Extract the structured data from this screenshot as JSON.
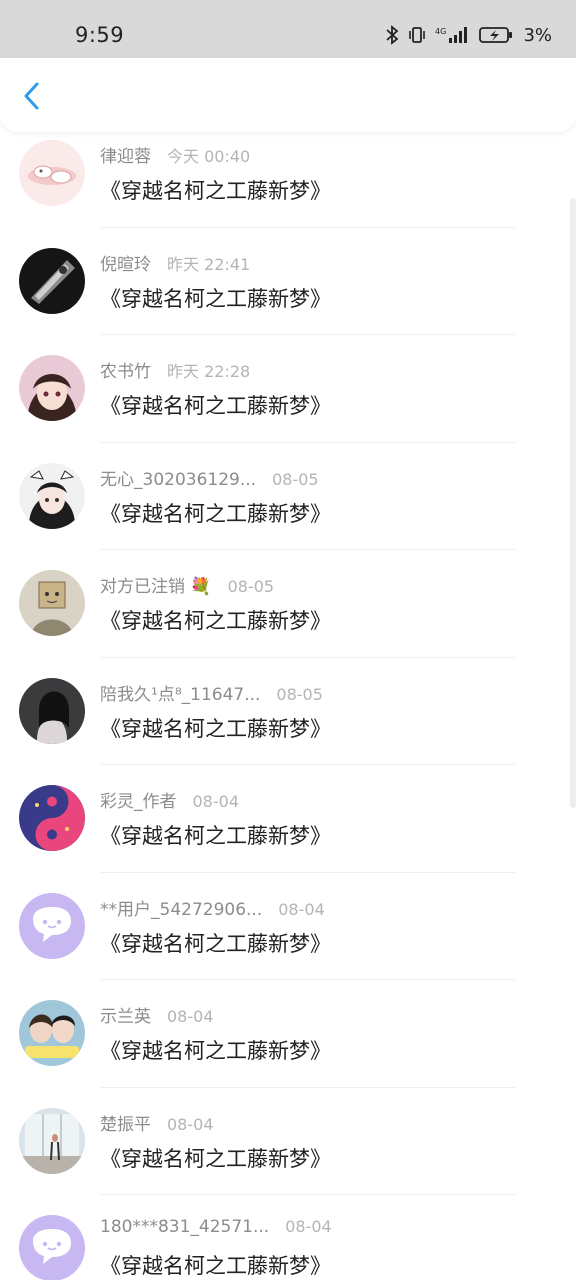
{
  "status_bar": {
    "time": "9:59",
    "network": "4G",
    "battery": "3%",
    "icons": [
      "bluetooth-icon",
      "vibrate-icon",
      "signal-icon",
      "battery-charging-icon"
    ]
  },
  "header": {
    "back_icon": "chevron-left-icon"
  },
  "items": [
    {
      "name": "律迎蓉",
      "time": "今天 00:40",
      "message": "《穿越名柯之工藤新梦》",
      "avatar": "pink-cartoon"
    },
    {
      "name": "倪暄玲",
      "time": "昨天 22:41",
      "message": "《穿越名柯之工藤新梦》",
      "avatar": "dark-gadget"
    },
    {
      "name": "农书竹",
      "time": "昨天 22:28",
      "message": "《穿越名柯之工藤新梦》",
      "avatar": "anime-girl"
    },
    {
      "name": "无心_302036129...",
      "time": "08-05",
      "message": "《穿越名柯之工藤新梦》",
      "avatar": "anime-girl-2"
    },
    {
      "name": "对方已注销 💐",
      "time": "08-05",
      "message": "《穿越名柯之工藤新梦》",
      "avatar": "box-head"
    },
    {
      "name": "陪我久¹点⁸_11647...",
      "time": "08-05",
      "message": "《穿越名柯之工藤新梦》",
      "avatar": "girl-photo"
    },
    {
      "name": "彩灵_作者",
      "time": "08-04",
      "message": "《穿越名柯之工藤新梦》",
      "avatar": "yin-yang"
    },
    {
      "name": "**用户_54272906...",
      "time": "08-04",
      "message": "《穿越名柯之工藤新梦》",
      "avatar": "default-chat"
    },
    {
      "name": "示兰英",
      "time": "08-04",
      "message": "《穿越名柯之工藤新梦》",
      "avatar": "couple"
    },
    {
      "name": "楚振平",
      "time": "08-04",
      "message": "《穿越名柯之工藤新梦》",
      "avatar": "window-scene"
    },
    {
      "name": "180***831_42571...",
      "time": "08-04",
      "message": "《穿越名柯之工藤新梦》",
      "avatar": "default-chat"
    }
  ],
  "colors": {
    "accent": "#2f9bea",
    "name": "#8c8c8c",
    "time": "#b4b4b4",
    "message": "#222222",
    "default_avatar": "#c8b8f2"
  }
}
